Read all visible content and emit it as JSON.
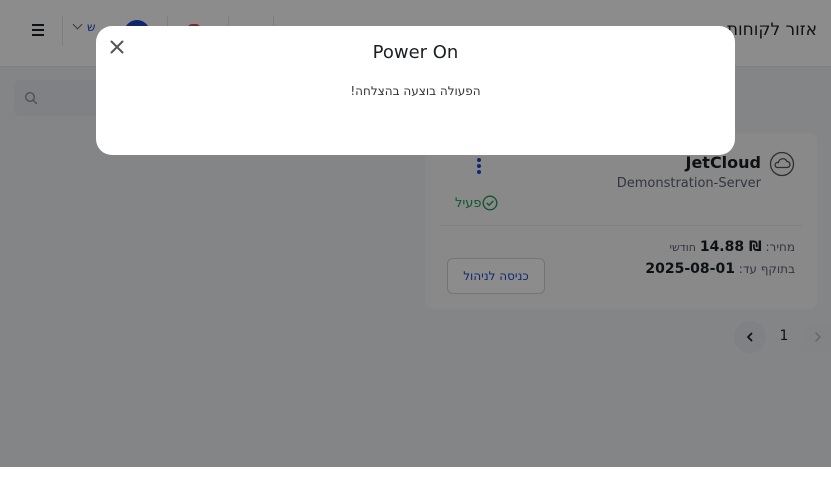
{
  "header": {
    "title": "אזור לקוחות",
    "language_value": "ש"
  },
  "server_card": {
    "name": "JetCloud",
    "subtitle": "Demonstration-Server",
    "status": "פעיל",
    "price_label": "מחיר:",
    "price_value": "₪ 14.88",
    "price_period": "חודשי",
    "valid_label": "בתוקף עד:",
    "valid_value": "2025-08-01",
    "manage_button": "כניסה לניהול"
  },
  "pagination": {
    "current_page": "1"
  },
  "modal": {
    "title": "Power On",
    "message": "הפעולה בוצעה בהצלחה!"
  },
  "colors": {
    "accent": "#1d49c6",
    "status_green": "#1f9d55",
    "overlay": "rgba(0,0,0,0.45)"
  }
}
